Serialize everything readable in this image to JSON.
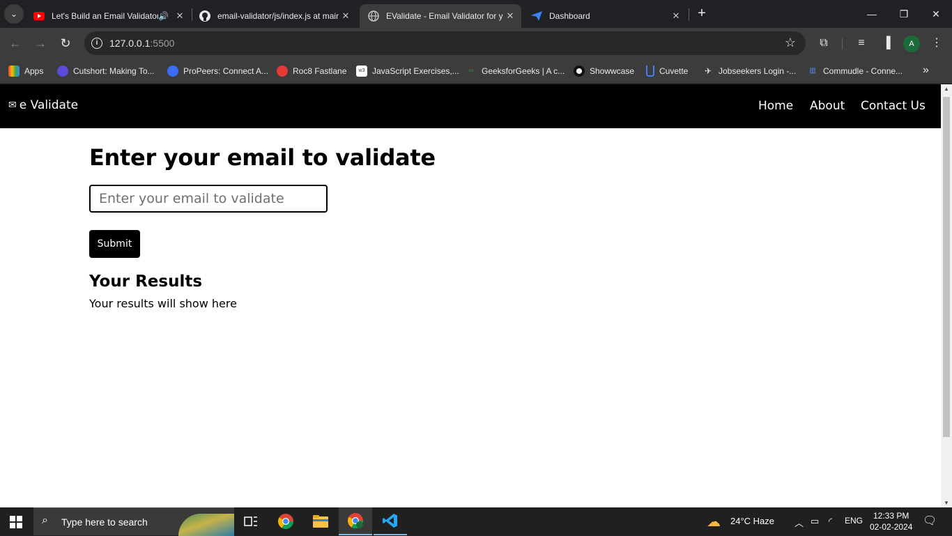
{
  "browser": {
    "tabs": [
      {
        "title": "Let's Build an Email Validator",
        "favicon": "youtube-icon"
      },
      {
        "title": "email-validator/js/index.js at main",
        "favicon": "github-icon"
      },
      {
        "title": "EValidate - Email Validator for you",
        "favicon": "globe-icon"
      },
      {
        "title": "Dashboard",
        "favicon": "send-icon"
      }
    ],
    "url_host": "127.0.0.1",
    "url_port": ":5500",
    "avatar_letter": "A",
    "bookmarks": [
      "Apps",
      "Cutshort: Making To...",
      "ProPeers: Connect A...",
      "Roc8 Fastlane",
      "JavaScript Exercises,...",
      "GeeksforGeeks | A c...",
      "Showwcase",
      "Cuvette",
      "Jobseekers Login -...",
      "Commudle - Conne..."
    ]
  },
  "site": {
    "brand": "e Validate",
    "nav": [
      "Home",
      "About",
      "Contact Us"
    ],
    "heading": "Enter your email to validate",
    "input_placeholder": "Enter your email to validate",
    "submit_label": "Submit",
    "results_heading": "Your Results",
    "results_text": "Your results will show here"
  },
  "taskbar": {
    "search_placeholder": "Type here to search",
    "weather": "24°C  Haze",
    "language": "ENG",
    "time": "12:33 PM",
    "date": "02-02-2024"
  },
  "colors": {
    "navbar_bg": "#000000",
    "button_bg": "#000000",
    "chrome_dark": "#202124",
    "chrome_toolbar": "#3c3c3c"
  }
}
